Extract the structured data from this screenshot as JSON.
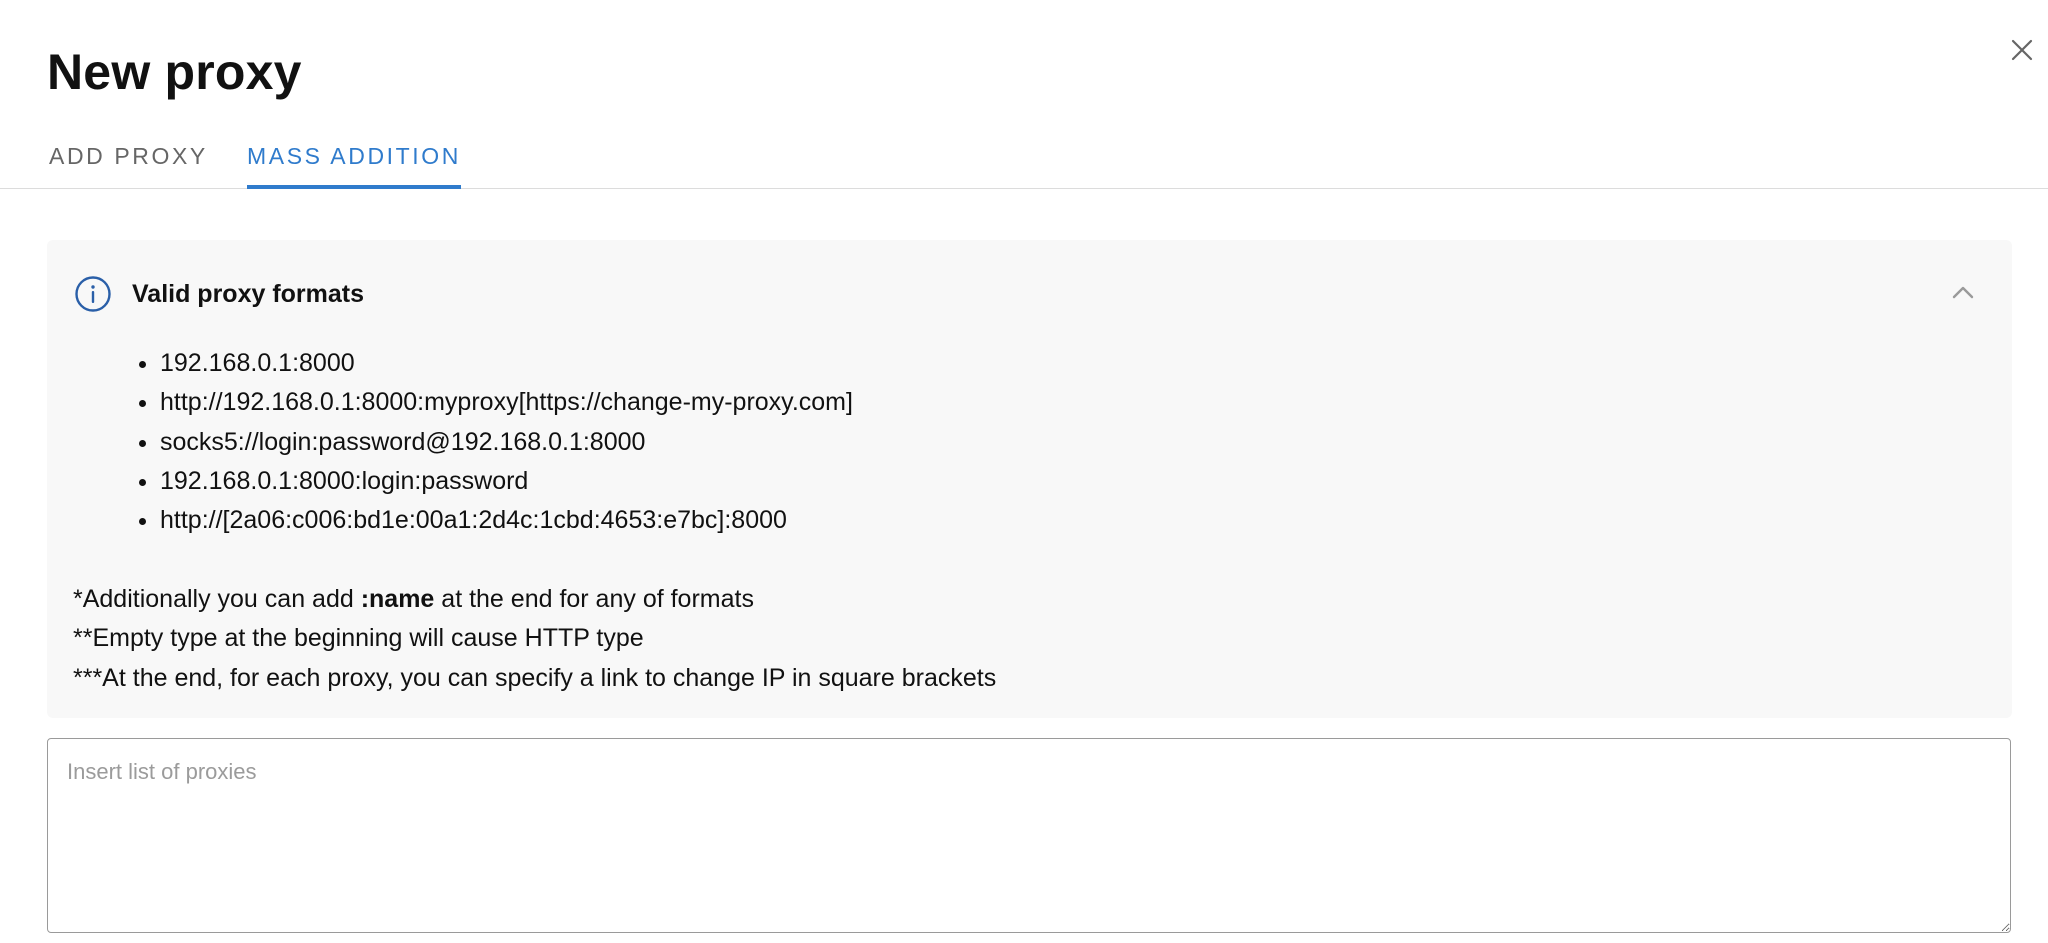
{
  "dialog": {
    "title": "New proxy",
    "close_icon": "close-icon"
  },
  "tabs": [
    {
      "label": "ADD PROXY",
      "active": false
    },
    {
      "label": "MASS ADDITION",
      "active": true
    }
  ],
  "info": {
    "icon": "info-icon",
    "title": "Valid proxy formats",
    "collapse_icon": "chevron-up-icon",
    "formats": [
      "192.168.0.1:8000",
      "http://192.168.0.1:8000:myproxy[https://change-my-proxy.com]",
      "socks5://login:password@192.168.0.1:8000",
      "192.168.0.1:8000:login:password",
      "http://[2a06:c006:bd1e:00a1:2d4c:1cbd:4653:e7bc]:8000"
    ],
    "note1_before": "*Additionally you can add ",
    "note1_bold": ":name",
    "note1_after": " at the end for any of formats",
    "note2": "**Empty type at the beginning will cause HTTP type",
    "note3": "***At the end, for each proxy, you can specify a link to change IP in square brackets"
  },
  "input": {
    "placeholder": "Insert list of proxies",
    "value": ""
  },
  "colors": {
    "accent": "#2f7bcc",
    "info_icon": "#2a5fa8",
    "panel_bg": "#f8f8f8"
  }
}
